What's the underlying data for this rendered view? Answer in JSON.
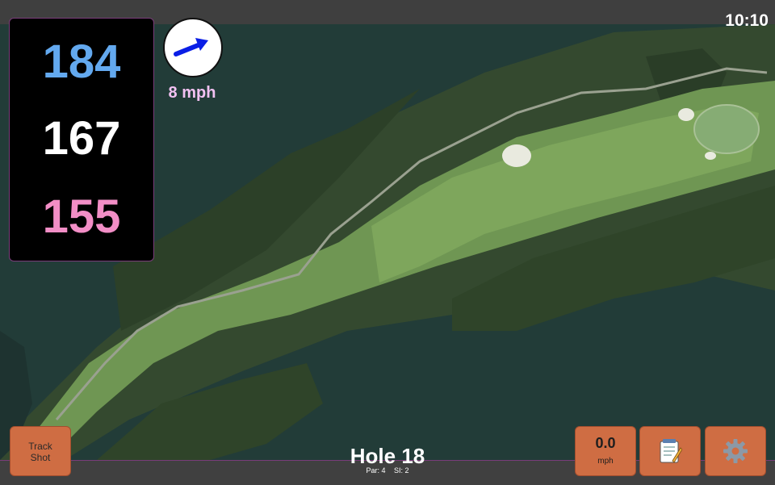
{
  "status": {
    "time": "10:10"
  },
  "distances": {
    "back": "184",
    "middle": "167",
    "front": "155"
  },
  "wind": {
    "speed_label": "8 mph",
    "icon": "wind-direction-arrow-icon",
    "arrow_color": "#0a1ee6"
  },
  "hole": {
    "title": "Hole 18",
    "par": "Par: 4",
    "stroke_index": "SI: 2"
  },
  "buttons": {
    "track_shot": [
      "Track",
      "Shot"
    ],
    "speed_value": "0.0",
    "speed_unit": "mph",
    "notes_icon": "notepad-icon",
    "settings_icon": "gear-icon"
  },
  "colors": {
    "back_distance": "#63a9ef",
    "middle_distance": "#ffffff",
    "front_distance": "#f28ec6",
    "button": "#cf6d43",
    "accent_border": "#7a3c7a"
  }
}
